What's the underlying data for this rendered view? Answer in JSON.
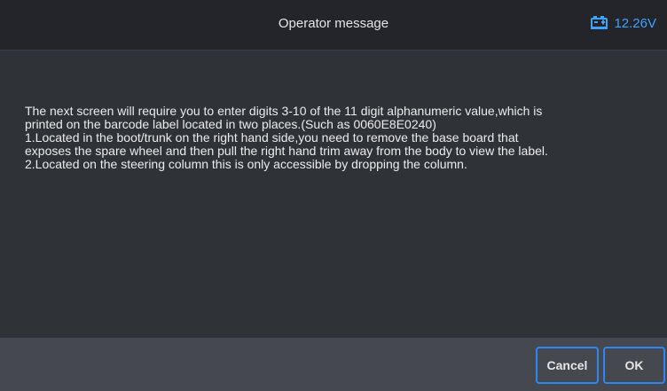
{
  "header": {
    "title": "Operator message",
    "battery_icon": "car-battery-icon",
    "voltage": "12.26V",
    "accent_color": "#3fa2ff"
  },
  "message": {
    "lines": [
      "The next screen will require you to enter digits 3-10 of the 11 digit alphanumeric value,which is",
      "printed on the barcode label located in two places.(Such as 0060E8E0240)",
      "1.Located in the boot/trunk on the right hand side,you need to remove the base board that",
      "exposes the spare wheel and then pull the right hand trim away from the body to view the label.",
      "2.Located on the steering column this is only accessible by dropping the column."
    ]
  },
  "footer": {
    "cancel_label": "Cancel",
    "ok_label": "OK",
    "button_border_color": "#2f86f0"
  }
}
